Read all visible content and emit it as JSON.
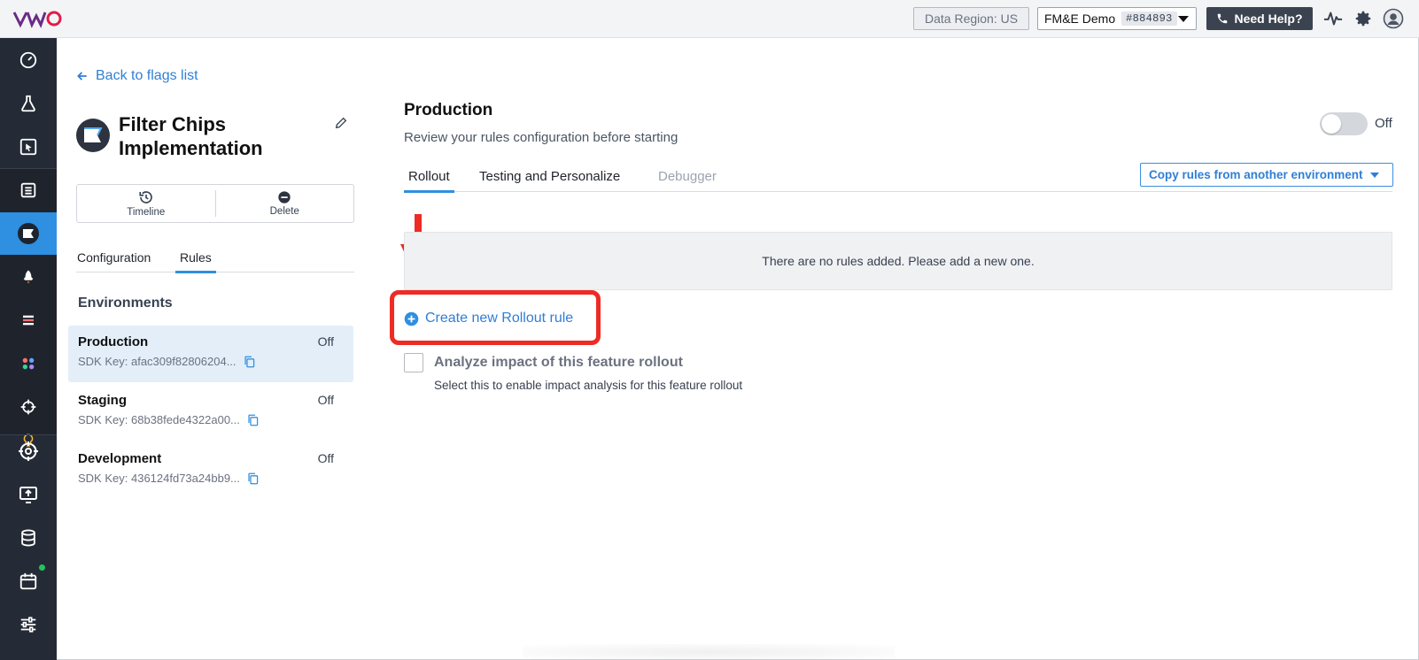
{
  "topbar": {
    "logo": "VWO",
    "data_region": "Data Region: US",
    "account_name": "FM&E Demo",
    "account_id": "#884893",
    "help_label": "Need Help?",
    "icons": [
      "activity-icon",
      "gear-icon",
      "user-avatar-icon"
    ]
  },
  "sidebar": {
    "items": [
      "dashboard-icon",
      "flask-icon",
      "cursor-icon",
      "document-icon",
      "flag-icon",
      "rocket-icon",
      "list-icon",
      "apps-icon",
      "crosshair-icon",
      "lightbulb-icon",
      "target-icon",
      "monitor-upload-icon",
      "database-icon",
      "calendar-icon",
      "sliders-icon"
    ],
    "active": "flag-icon"
  },
  "left_panel": {
    "back_label": "Back to flags list",
    "flag_title": "Filter Chips Implementation",
    "actions": [
      {
        "label": "Timeline",
        "icon": "history-icon"
      },
      {
        "label": "Delete",
        "icon": "minus-circle-icon"
      }
    ],
    "tabs": [
      {
        "label": "Configuration",
        "active": false
      },
      {
        "label": "Rules",
        "active": true
      }
    ],
    "environments_heading": "Environments",
    "environments": [
      {
        "name": "Production",
        "status": "Off",
        "sdk_label": "SDK Key:",
        "sdk_key": "afac309f82806204...",
        "active": true
      },
      {
        "name": "Staging",
        "status": "Off",
        "sdk_label": "SDK Key:",
        "sdk_key": "68b38fede4322a00...",
        "active": false
      },
      {
        "name": "Development",
        "status": "Off",
        "sdk_label": "SDK Key:",
        "sdk_key": "436124fd73a24bb9...",
        "active": false
      }
    ]
  },
  "main": {
    "title": "Production",
    "subtitle": "Review your rules configuration before starting",
    "toggle_label": "Off",
    "toggle_on": false,
    "tabs": [
      {
        "label": "Rollout",
        "state": "active"
      },
      {
        "label": "Testing and Personalize",
        "state": "normal"
      },
      {
        "label": "Debugger",
        "state": "disabled"
      }
    ],
    "copy_rules_label": "Copy rules from another environment",
    "empty_message": "There are no rules added. Please add a new one.",
    "create_rule_label": "Create new Rollout rule",
    "analyze_label": "Analyze impact of this feature rollout",
    "analyze_sub": "Select this to enable impact analysis for this feature rollout",
    "analyze_checked": false
  },
  "colors": {
    "accent": "#2f8fe0",
    "link": "#2f7fd6",
    "sidebar_bg": "#252b36",
    "annotation_red": "#ee2b24"
  }
}
